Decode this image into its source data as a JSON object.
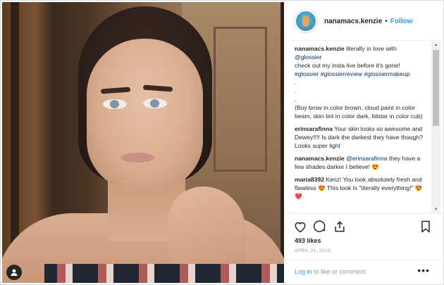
{
  "post": {
    "username": "nanamacs.kenzie",
    "follow_label": "Follow",
    "separator": "•",
    "caption": {
      "author": "nanamacs.kenzie",
      "text_1": " literally in love with ",
      "mention": "@glossier",
      "text_2": "check out my insta live before it's gone!",
      "hashtags": "#glossier #glossierreview #glossiermakeup",
      "dot_1": ".",
      "dot_2": ".",
      "dot_3": ".",
      "details": "(Boy brow in color brown, cloud paint in color beam, skin tint in color dark, lidstar in color cub)"
    },
    "comments": [
      {
        "user": "erinsarafinna",
        "text": " Your skin looks so awesome and Dewey!!!! Is dark the darkest they have though? Looks super light"
      },
      {
        "user": "nanamacs.kenzie",
        "mention": "@erinsarafinna",
        "text": " they have a few shades darker I believe! 😍"
      },
      {
        "user": "maria8392",
        "text": " Kenz! You look absolutely fresh and flawless 😍 This look is \"literally everything!\" 😍❤️"
      }
    ],
    "likes": "493 likes",
    "date": "APRIL 21, 2018",
    "login_link": "Log in",
    "login_rest": " to like or comment.",
    "more_label": "•••"
  },
  "icons": {
    "like": "heart-icon",
    "comment": "comment-icon",
    "share": "share-icon",
    "save": "bookmark-icon",
    "user_tag": "user-icon"
  }
}
